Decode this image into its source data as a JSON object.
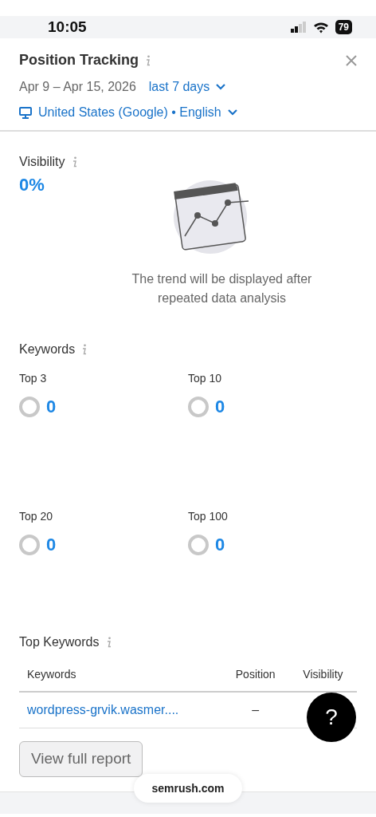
{
  "status_bar": {
    "time": "10:05",
    "battery": "79"
  },
  "header": {
    "title": "Position Tracking",
    "date_range": "Apr 9 – Apr 15, 2026",
    "period": "last 7 days",
    "location": "United States (Google) • English"
  },
  "visibility": {
    "label": "Visibility",
    "value": "0%",
    "empty_message": "The trend will be displayed after repeated data analysis"
  },
  "keywords": {
    "label": "Keywords",
    "groups": [
      {
        "label": "Top 3",
        "value": "0"
      },
      {
        "label": "Top 10",
        "value": "0"
      },
      {
        "label": "Top 20",
        "value": "0"
      },
      {
        "label": "Top 100",
        "value": "0"
      }
    ]
  },
  "top_keywords": {
    "label": "Top Keywords",
    "columns": [
      "Keywords",
      "Position",
      "Visibility"
    ],
    "rows": [
      {
        "keyword": "wordpress-grvik.wasmer....",
        "position": "–"
      }
    ]
  },
  "report_button": "View full report",
  "help_button": "?",
  "browser_url": "semrush.com"
}
